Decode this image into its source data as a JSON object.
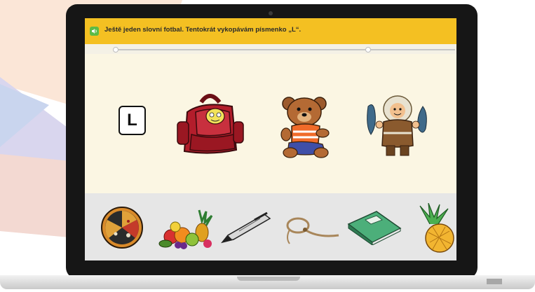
{
  "app": {
    "prompt": "Ještě jeden slovní fotbal. Tentokrát vykopávám písmenko „L“.",
    "letter": "L"
  },
  "colors": {
    "topbar": "#f4c022",
    "screen_bg": "#fbf6e3",
    "tray_bg": "#e6e6e6",
    "speaker_button": "#5dbb46"
  },
  "chain": {
    "items": [
      {
        "icon": "backpack-icon"
      },
      {
        "icon": "teddy-bear-icon"
      },
      {
        "icon": "eskimo-with-fish-icon"
      }
    ]
  },
  "tray": {
    "items": [
      {
        "icon": "pizza-icon"
      },
      {
        "icon": "fruit-pile-icon"
      },
      {
        "icon": "pen-icon"
      },
      {
        "icon": "rope-lasso-icon"
      },
      {
        "icon": "notebook-icon"
      },
      {
        "icon": "pineapple-icon"
      }
    ]
  }
}
